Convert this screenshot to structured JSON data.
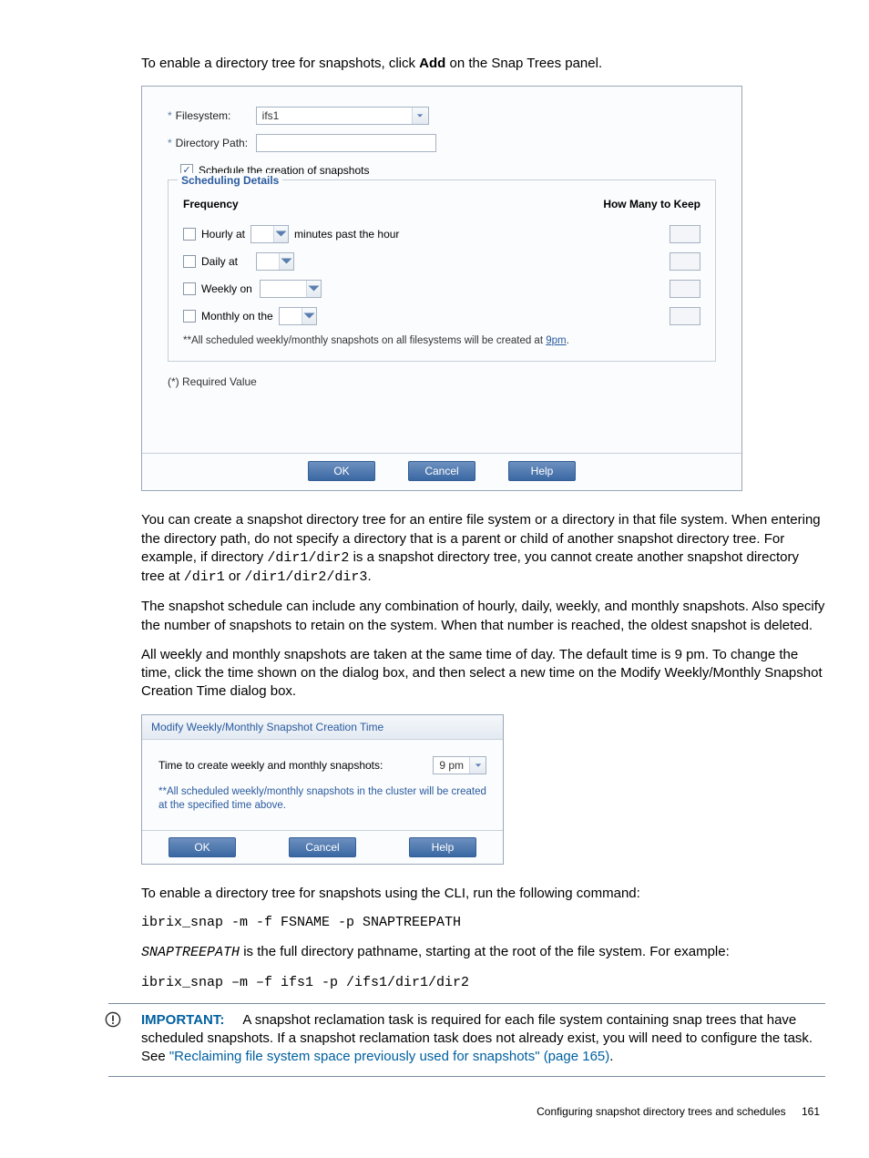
{
  "intro": {
    "prefix": "To enable a directory tree for snapshots, click ",
    "bold": "Add",
    "suffix": " on the Snap Trees panel."
  },
  "dialog1": {
    "filesystem_label": "Filesystem:",
    "filesystem_value": "ifs1",
    "dirpath_label": "Directory Path:",
    "schedule_checkbox_label": "Schedule the creation of snapshots",
    "fieldset_legend": "Scheduling Details",
    "col_frequency": "Frequency",
    "col_keep": "How Many to Keep",
    "rows": {
      "hourly": {
        "label": "Hourly at",
        "suffix": "minutes past the hour"
      },
      "daily": {
        "label": "Daily at"
      },
      "weekly": {
        "label": "Weekly on"
      },
      "monthly": {
        "label": "Monthly on the"
      }
    },
    "note_prefix": "**All scheduled weekly/monthly snapshots on all filesystems will be created at ",
    "note_link": "9pm",
    "note_suffix": ".",
    "required_note": "(*) Required Value",
    "buttons": {
      "ok": "OK",
      "cancel": "Cancel",
      "help": "Help"
    }
  },
  "para1": {
    "a": "You can create a snapshot directory tree for an entire file system or a directory in that file system. When entering the directory path, do not specify a directory that is a parent or child of another snapshot directory tree. For example, if directory ",
    "code1": "/dir1/dir2",
    "b": " is a snapshot directory tree, you cannot create another snapshot directory tree at ",
    "code2": "/dir1",
    "c": " or ",
    "code3": "/dir1/dir2/dir3",
    "d": "."
  },
  "para2": "The snapshot schedule can include any combination of hourly, daily, weekly, and monthly snapshots. Also specify the number of snapshots to retain on the system. When that number is reached, the oldest snapshot is deleted.",
  "para3": "All weekly and monthly snapshots are taken at the same time of day. The default time is 9 pm. To change the time, click the time shown on the dialog box, and then select a new time on the Modify Weekly/Monthly Snapshot Creation Time dialog box.",
  "dialog2": {
    "title": "Modify Weekly/Monthly Snapshot Creation Time",
    "label": "Time to create weekly and monthly snapshots:",
    "value": "9 pm",
    "note": "**All scheduled weekly/monthly snapshots in the cluster will be created at the specified time above.",
    "buttons": {
      "ok": "OK",
      "cancel": "Cancel",
      "help": "Help"
    }
  },
  "cli_intro": "To enable a directory tree for snapshots using the CLI, run the following command:",
  "cli_cmd1": "ibrix_snap -m -f FSNAME -p SNAPTREEPATH",
  "cli_explain": {
    "var": "SNAPTREEPATH",
    "text": " is the full directory pathname, starting at the root of the file system. For example:"
  },
  "cli_cmd2": "ibrix_snap –m –f ifs1 -p /ifs1/dir1/dir2",
  "important": {
    "label": "IMPORTANT:",
    "body": "A snapshot reclamation task is required for each file system containing snap trees that have scheduled snapshots. If a snapshot reclamation task does not already exist, you will need to configure the task. See ",
    "xref": "\"Reclaiming file system space previously used for snapshots\" (page 165)",
    "end": "."
  },
  "footer": {
    "section": "Configuring snapshot directory trees and schedules",
    "page": "161"
  }
}
